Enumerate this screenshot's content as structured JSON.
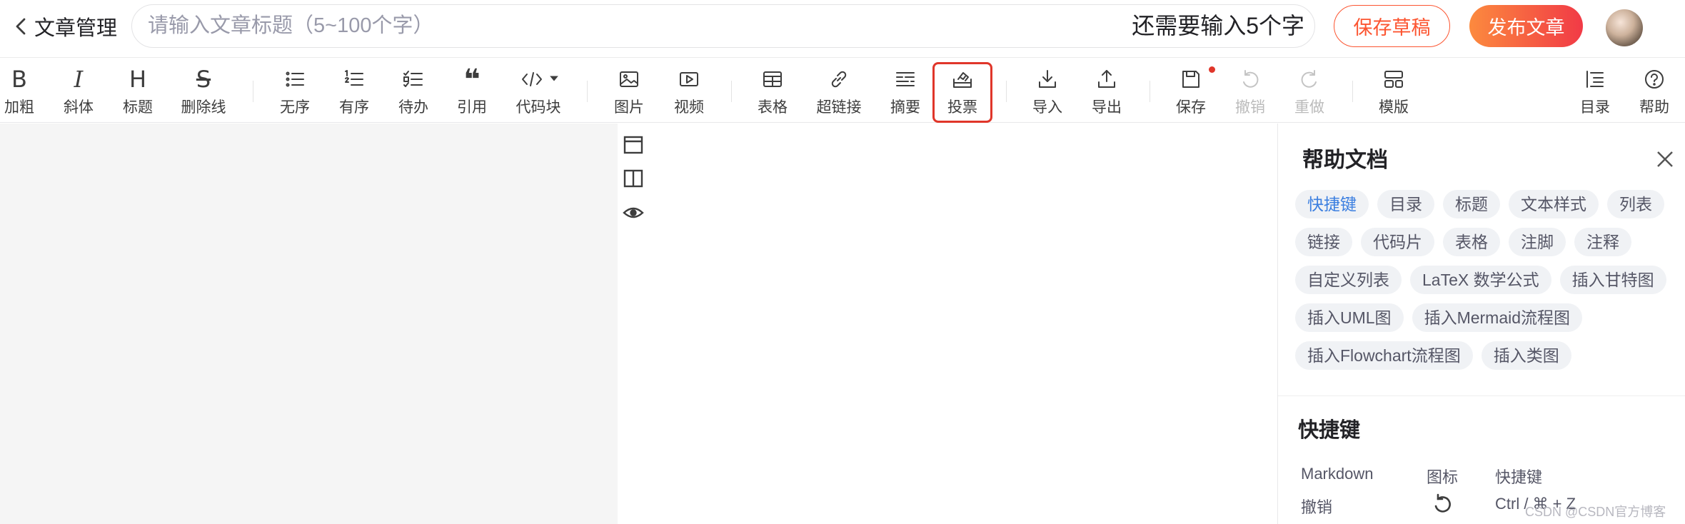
{
  "header": {
    "back_label": "文章管理",
    "title_value": "",
    "title_placeholder": "请输入文章标题（5~100个字）",
    "remain_text": "还需要输入5个字",
    "save_draft_label": "保存草稿",
    "publish_label": "发布文章"
  },
  "toolbar": {
    "bold": "加粗",
    "italic": "斜体",
    "heading": "标题",
    "strike": "删除线",
    "ul": "无序",
    "ol": "有序",
    "todo": "待办",
    "quote": "引用",
    "code": "代码块",
    "image": "图片",
    "video": "视频",
    "table": "表格",
    "link": "超链接",
    "summary": "摘要",
    "vote": "投票",
    "import": "导入",
    "export": "导出",
    "save": "保存",
    "undo": "撤销",
    "redo": "重做",
    "template": "模版",
    "toc": "目录",
    "help": "帮助"
  },
  "help": {
    "title": "帮助文档",
    "tags": [
      [
        "快捷键",
        "目录",
        "标题",
        "文本样式",
        "列表"
      ],
      [
        "链接",
        "代码片",
        "表格",
        "注脚",
        "注释"
      ],
      [
        "自定义列表",
        "LaTeX 数学公式",
        "插入甘特图"
      ],
      [
        "插入UML图",
        "插入Mermaid流程图"
      ],
      [
        "插入Flowchart流程图",
        "插入类图"
      ]
    ],
    "active_tag": "快捷键",
    "shortcut_title": "快捷键",
    "shortcut_headers": [
      "Markdown",
      "图标",
      "快捷键"
    ],
    "shortcut_rows": [
      {
        "name": "撤销",
        "icon": "undo-icon",
        "keys": "Ctrl / ⌘ + Z"
      }
    ]
  },
  "watermark": "CSDN @CSDN官方博客",
  "colors": {
    "accent": "#fc5531",
    "publish_gradient_start": "#fc8a3e",
    "publish_gradient_end": "#f13a46",
    "highlight_border": "#e0362a",
    "active_tag": "#3b7fe0"
  }
}
